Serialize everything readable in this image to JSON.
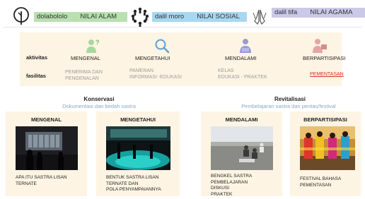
{
  "header": {
    "items": [
      {
        "icon": "tree-icon",
        "text_left": "dolabololo",
        "text_right": "NILAI ALAM",
        "color": "#b8e0b0"
      },
      {
        "icon": "people-circle-icon",
        "text_left": "dalil moro",
        "text_right": "NILAI SOSIAL",
        "color": "#a8d8f0"
      },
      {
        "icon": "praying-hands-icon",
        "text_left": "dalil tifa",
        "text_right": "NILAI AGAMA",
        "color": "#ccc8e8"
      }
    ]
  },
  "panel": {
    "row_labels": {
      "activity": "aktivitas",
      "facility": "fasilitas"
    },
    "columns": [
      {
        "title": "MENGENAL",
        "icon": "person-question-icon",
        "icon_color": "#a8d8a0",
        "facility": [
          "PENERIMA DAN",
          "PENGENALAN"
        ],
        "facility_red": false
      },
      {
        "title": "MENGETAHUI",
        "icon": "search-icon",
        "icon_color": "#5aa0d8",
        "facility": [
          "PAMERAN",
          "INFORMASI -EDUKASI"
        ],
        "facility_red": false
      },
      {
        "title": "MENDALAMI",
        "icon": "person-study-icon",
        "icon_color": "#9a9ad8",
        "facility": [
          "KELAS",
          "EDUKASI - PRAKTEK"
        ],
        "facility_red": false
      },
      {
        "title": "BERPARTISIPASI",
        "icon": "person-present-icon",
        "icon_color": "#e6a4a4",
        "facility": [
          "PEMENTASAN"
        ],
        "facility_red": true
      }
    ]
  },
  "sections": {
    "conservation": {
      "title": "Konservasi",
      "subtitle": "Dokumentasi dan bedah sastra"
    },
    "revitalization": {
      "title": "Revitalisasi",
      "subtitle": "Pembelajaran sastra dan pentas/festival"
    }
  },
  "cards": [
    {
      "title": "MENGENAL",
      "lines": [
        "APA ITU SASTRA LISAN",
        "TERNATE"
      ],
      "photo": "dark-gallery-photo"
    },
    {
      "title": "MENGETAHUI",
      "lines": [
        "BENTUK SASTRA LISAN",
        "TERNATE DAN",
        "POLA PENYAMPAIANNYA"
      ],
      "photo": "immersive-room-photo"
    },
    {
      "title": "MENDALAMI",
      "lines": [
        "BENGKEL SASTRA",
        "PEMBELAJARAN",
        "DISKUSI",
        "PRAKTEK"
      ],
      "photo": "outdoor-class-photo"
    },
    {
      "title": "BERPARTISIPASI",
      "lines": [
        "FESTIVAL BAHASA",
        "PEMENTASAN"
      ],
      "photo": "festival-dance-photo"
    }
  ]
}
